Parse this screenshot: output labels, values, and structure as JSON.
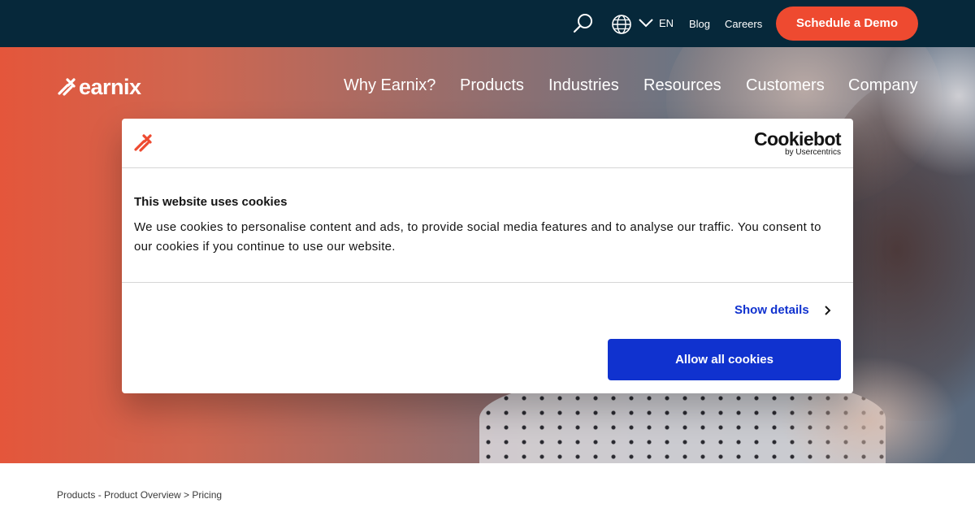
{
  "topbar": {
    "language": "EN",
    "blog": "Blog",
    "careers": "Careers",
    "demo_button": "Schedule a Demo",
    "icons": [
      "search-icon",
      "globe-icon",
      "chevron-down-icon"
    ]
  },
  "header": {
    "logo_text": "earnix",
    "nav": [
      "Why Earnix?",
      "Products",
      "Industries",
      "Resources",
      "Customers",
      "Company"
    ]
  },
  "cookie_dialog": {
    "provider_name": "Cookiebot",
    "provider_by": "by Usercentrics",
    "title": "This website uses cookies",
    "body": "We use cookies to personalise content and ads, to provide social media features and to analyse our traffic. You consent to our cookies if you continue to use our website.",
    "show_details": "Show details",
    "allow_all": "Allow all cookies"
  },
  "breadcrumb": {
    "text": "Products - Product Overview > Pricing"
  },
  "colors": {
    "topbar_bg": "#06283a",
    "accent": "#ee4a30",
    "cookie_button": "#1032cf"
  }
}
